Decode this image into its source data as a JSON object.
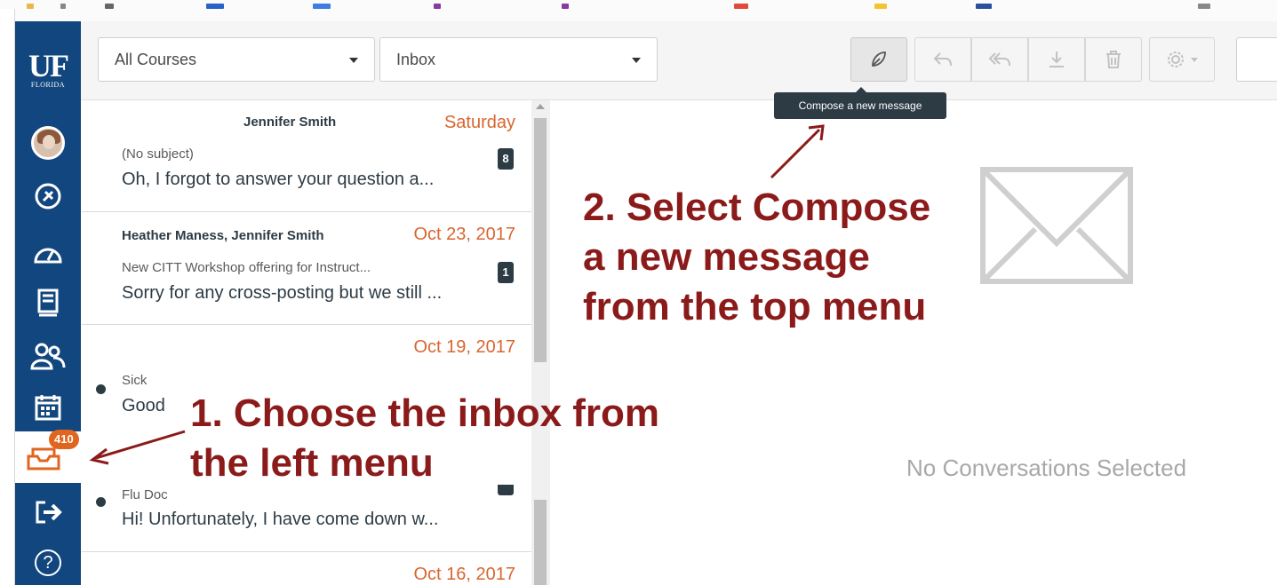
{
  "global_nav": {
    "logo": {
      "letters": "UF",
      "text": "FLORIDA"
    },
    "items": [
      {
        "name": "account",
        "icon": "avatar-icon"
      },
      {
        "name": "admin",
        "icon": "shield-icon"
      },
      {
        "name": "dashboard",
        "icon": "dashboard-icon"
      },
      {
        "name": "courses",
        "icon": "book-icon"
      },
      {
        "name": "groups",
        "icon": "people-icon"
      },
      {
        "name": "calendar",
        "icon": "calendar-icon"
      },
      {
        "name": "inbox",
        "icon": "inbox-icon",
        "badge": "410"
      },
      {
        "name": "commons",
        "icon": "arrow-right-icon"
      },
      {
        "name": "help",
        "icon": "help-icon",
        "glyph": "?"
      }
    ]
  },
  "toolbar": {
    "course_filter": "All Courses",
    "mailbox_filter": "Inbox",
    "buttons": [
      "compose-icon",
      "reply-icon",
      "reply-all-icon",
      "archive-icon",
      "delete-icon",
      "gear-icon"
    ]
  },
  "tooltip": "Compose a new message",
  "conversations": [
    {
      "from": "Jennifer Smith",
      "date": "Saturday",
      "subject": "(No subject)",
      "preview": "Oh, I forgot to answer your question a...",
      "count": "8",
      "unread": false
    },
    {
      "from": "Heather Maness, Jennifer Smith",
      "date": "Oct 23, 2017",
      "subject": "New CITT Workshop offering for Instruct...",
      "preview": "Sorry for any cross-posting but we still ...",
      "count": "1",
      "unread": false
    },
    {
      "from": "",
      "date": "Oct 19, 2017",
      "subject": "Sick",
      "preview": "Good",
      "count": "",
      "unread": true
    },
    {
      "from": "",
      "date": "",
      "subject": "Flu Doc",
      "preview": "Hi! Unfortunately, I have come down w...",
      "count": "",
      "unread": true
    },
    {
      "from": "",
      "date": "Oct 16, 2017",
      "subject": "",
      "preview": "",
      "count": "",
      "unread": false
    }
  ],
  "empty_state": "No Conversations Selected",
  "annotations": {
    "step2": [
      "2. Select Compose",
      "a new message",
      "from the top menu"
    ],
    "step1": [
      "1. Choose the inbox from",
      "the left menu"
    ]
  },
  "colors": {
    "nav": "#12467e",
    "date": "#d8662f",
    "annotation": "#8b1a1a",
    "badge": "#e0661f"
  }
}
